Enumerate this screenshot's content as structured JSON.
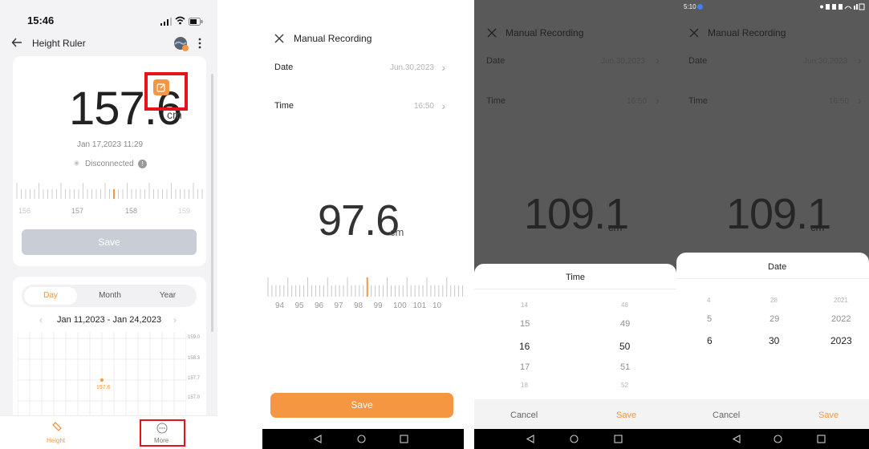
{
  "panel1": {
    "status_time": "15:46",
    "title": "Height Ruler",
    "value": "157.6",
    "unit": "cm",
    "timestamp": "Jan 17,2023 11:29",
    "connection": "Disconnected",
    "ruler_labels": [
      "156",
      "157",
      "158",
      "159"
    ],
    "save_label": "Save",
    "tabs": [
      "Day",
      "Month",
      "Year"
    ],
    "date_range": "Jan 11,2023 - Jan 24,2023",
    "chart_y_ticks": [
      "159.0",
      "158.3",
      "157.7",
      "157.0"
    ],
    "chart_point_label": "157.6",
    "nav": {
      "height_label": "Height",
      "more_label": "More"
    },
    "accent": "#f59642",
    "highlight": "#e8121b"
  },
  "panel2": {
    "title": "Manual Recording",
    "date_label": "Date",
    "date_value": "Jun.30,2023",
    "time_label": "Time",
    "time_value": "16:50",
    "value": "97.6",
    "unit": "cm",
    "ruler_labels": [
      "94",
      "95",
      "96",
      "97",
      "98",
      "99",
      "100",
      "101",
      "10"
    ],
    "save_label": "Save"
  },
  "panel3": {
    "title": "Manual Recording",
    "date_label": "Date",
    "date_value": "Jun.30,2023",
    "time_label": "Time",
    "time_value": "16:50",
    "value": "109.1",
    "unit": "cm",
    "sheet_title": "Time",
    "hours": [
      "14",
      "15",
      "16",
      "17",
      "18"
    ],
    "minutes": [
      "48",
      "49",
      "50",
      "51",
      "52"
    ],
    "cancel_label": "Cancel",
    "save_label": "Save"
  },
  "panel4": {
    "status_time": "5:10",
    "title": "Manual Recording",
    "date_label": "Date",
    "date_value": "Jun.30,2023",
    "time_label": "Time",
    "time_value": "16:50",
    "value": "109.1",
    "unit": "cm",
    "sheet_title": "Date",
    "months": [
      "4",
      "5",
      "6"
    ],
    "days": [
      "28",
      "29",
      "30"
    ],
    "years": [
      "2021",
      "2022",
      "2023"
    ],
    "cancel_label": "Cancel",
    "save_label": "Save"
  }
}
